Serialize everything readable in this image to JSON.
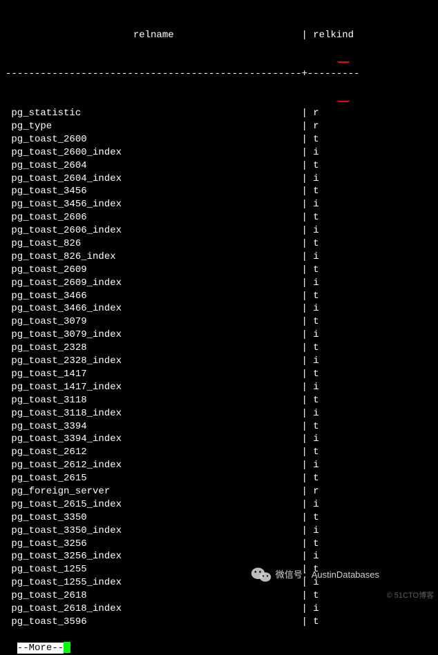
{
  "header": {
    "col1": "relname",
    "col2": "relkind"
  },
  "divider": {
    "col1_dashes": "-------------------------------------------------",
    "col2_dashes": "---------"
  },
  "rows": [
    {
      "relname": "pg_statistic",
      "relkind": "r"
    },
    {
      "relname": "pg_type",
      "relkind": "r"
    },
    {
      "relname": "pg_toast_2600",
      "relkind": "t"
    },
    {
      "relname": "pg_toast_2600_index",
      "relkind": "i"
    },
    {
      "relname": "pg_toast_2604",
      "relkind": "t"
    },
    {
      "relname": "pg_toast_2604_index",
      "relkind": "i"
    },
    {
      "relname": "pg_toast_3456",
      "relkind": "t"
    },
    {
      "relname": "pg_toast_3456_index",
      "relkind": "i"
    },
    {
      "relname": "pg_toast_2606",
      "relkind": "t"
    },
    {
      "relname": "pg_toast_2606_index",
      "relkind": "i"
    },
    {
      "relname": "pg_toast_826",
      "relkind": "t"
    },
    {
      "relname": "pg_toast_826_index",
      "relkind": "i"
    },
    {
      "relname": "pg_toast_2609",
      "relkind": "t"
    },
    {
      "relname": "pg_toast_2609_index",
      "relkind": "i"
    },
    {
      "relname": "pg_toast_3466",
      "relkind": "t"
    },
    {
      "relname": "pg_toast_3466_index",
      "relkind": "i"
    },
    {
      "relname": "pg_toast_3079",
      "relkind": "t"
    },
    {
      "relname": "pg_toast_3079_index",
      "relkind": "i"
    },
    {
      "relname": "pg_toast_2328",
      "relkind": "t"
    },
    {
      "relname": "pg_toast_2328_index",
      "relkind": "i"
    },
    {
      "relname": "pg_toast_1417",
      "relkind": "t"
    },
    {
      "relname": "pg_toast_1417_index",
      "relkind": "i"
    },
    {
      "relname": "pg_toast_3118",
      "relkind": "t"
    },
    {
      "relname": "pg_toast_3118_index",
      "relkind": "i"
    },
    {
      "relname": "pg_toast_3394",
      "relkind": "t"
    },
    {
      "relname": "pg_toast_3394_index",
      "relkind": "i"
    },
    {
      "relname": "pg_toast_2612",
      "relkind": "t"
    },
    {
      "relname": "pg_toast_2612_index",
      "relkind": "i"
    },
    {
      "relname": "pg_toast_2615",
      "relkind": "t"
    },
    {
      "relname": "pg_foreign_server",
      "relkind": "r"
    },
    {
      "relname": "pg_toast_2615_index",
      "relkind": "i"
    },
    {
      "relname": "pg_toast_3350",
      "relkind": "t"
    },
    {
      "relname": "pg_toast_3350_index",
      "relkind": "i"
    },
    {
      "relname": "pg_toast_3256",
      "relkind": "t"
    },
    {
      "relname": "pg_toast_3256_index",
      "relkind": "i"
    },
    {
      "relname": "pg_toast_1255",
      "relkind": "t"
    },
    {
      "relname": "pg_toast_1255_index",
      "relkind": "i"
    },
    {
      "relname": "pg_toast_2618",
      "relkind": "t"
    },
    {
      "relname": "pg_toast_2618_index",
      "relkind": "i"
    },
    {
      "relname": "pg_toast_3596",
      "relkind": "t"
    }
  ],
  "pager": {
    "label": "--More--"
  },
  "watermark": {
    "wechat_label": "微信号：AustinDatabases",
    "corner": "© 51CTO博客"
  },
  "layout": {
    "col1_width": 49,
    "col2_width": 8
  }
}
